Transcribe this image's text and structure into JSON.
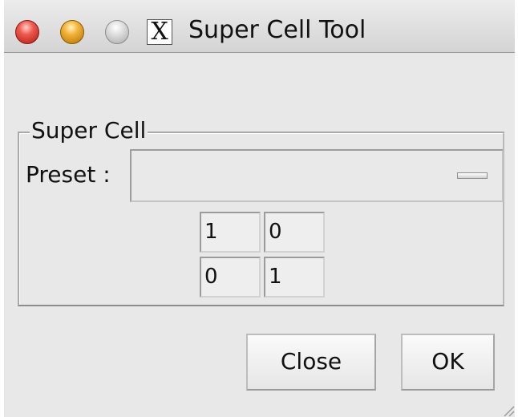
{
  "window": {
    "title": "Super Cell Tool",
    "title_icon": "X-icon",
    "title_icon_glyph": "X"
  },
  "group": {
    "title": "Super Cell",
    "preset_label": "Preset :",
    "preset_value": ""
  },
  "matrix": {
    "r0c0": "1",
    "r0c1": "0",
    "r1c0": "0",
    "r1c1": "1"
  },
  "buttons": {
    "close_label": "Close",
    "ok_label": "OK"
  }
}
